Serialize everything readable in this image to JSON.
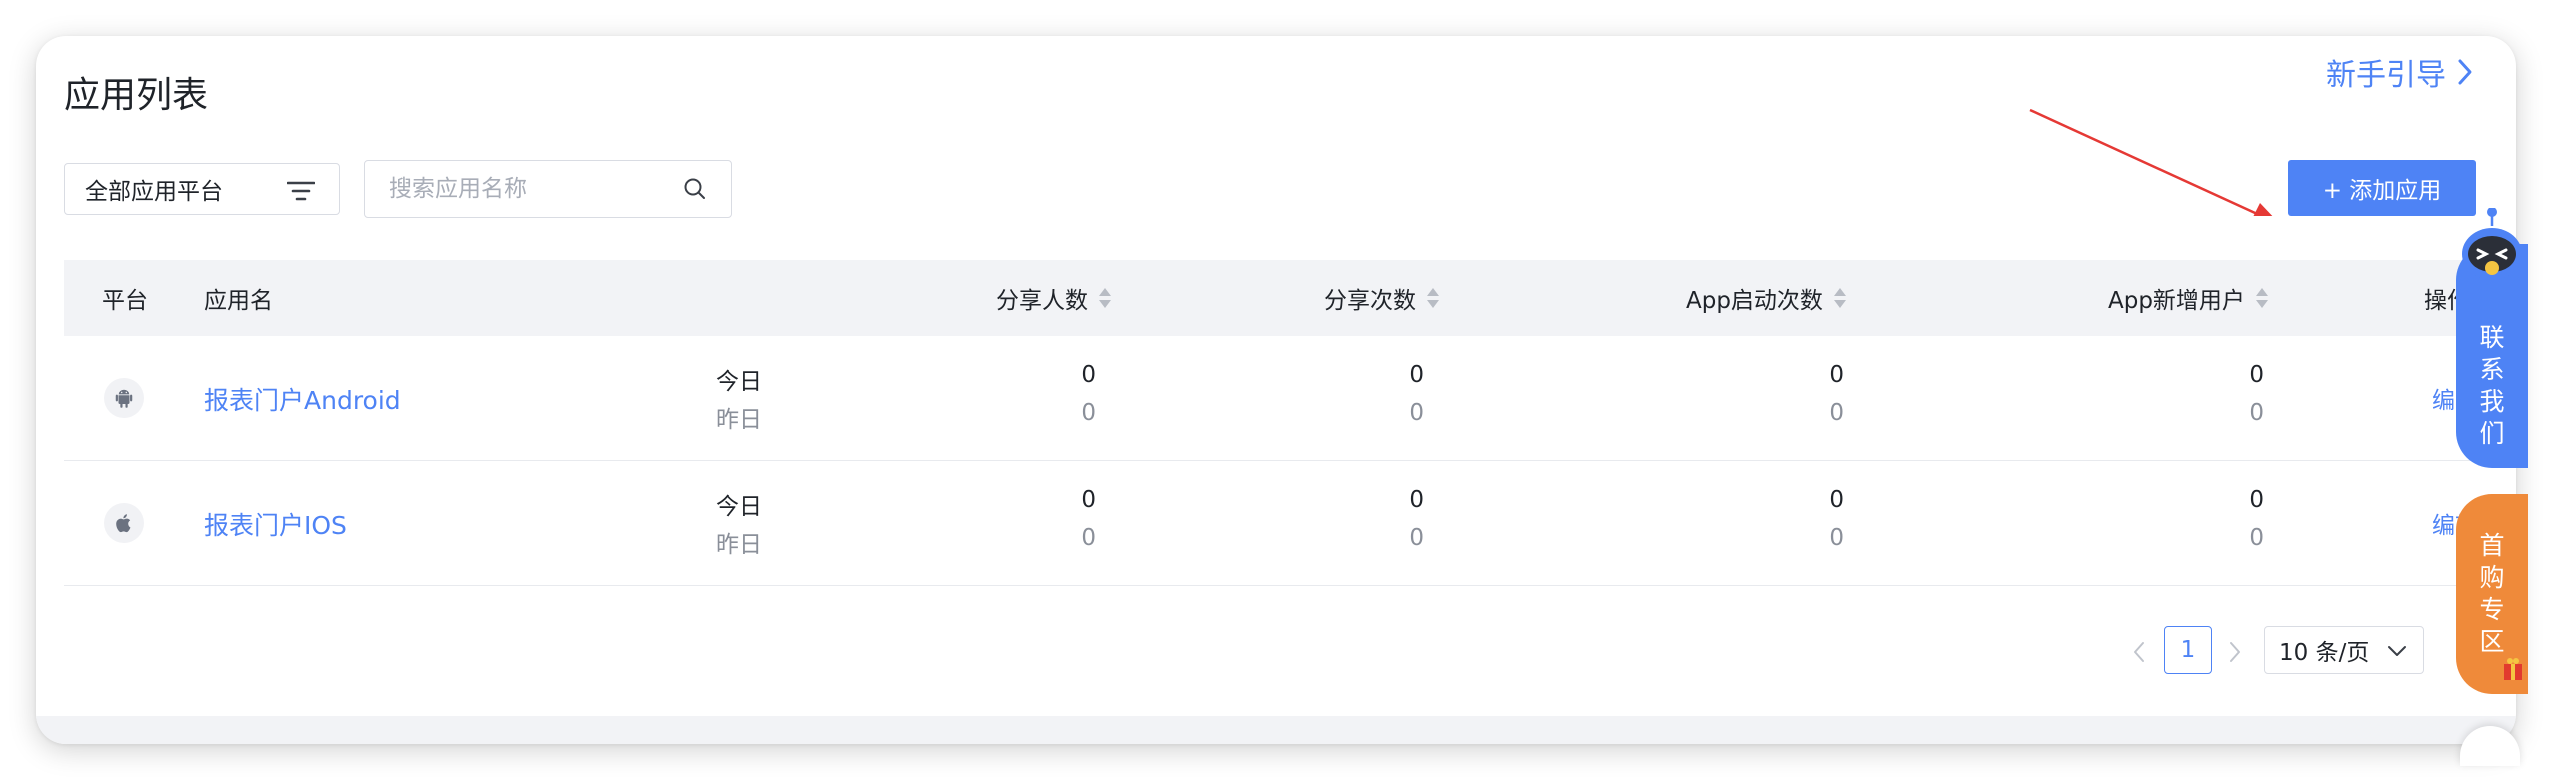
{
  "header": {
    "title": "应用列表",
    "guide_link": "新手引导"
  },
  "filters": {
    "platform_select": "全部应用平台",
    "search_placeholder": "搜索应用名称"
  },
  "toolbar": {
    "add_button": "+ 添加应用"
  },
  "table": {
    "columns": {
      "platform": "平台",
      "app_name": "应用名",
      "share_users": "分享人数",
      "share_count": "分享次数",
      "app_launches": "App启动次数",
      "new_users": "App新增用户",
      "actions": "操作"
    },
    "today_label": "今日",
    "yesterday_label": "昨日",
    "edit_label": "编辑",
    "rows": [
      {
        "platform_icon": "android-icon",
        "name": "报表门户Android",
        "share_users": {
          "today": "0",
          "yesterday": "0"
        },
        "share_count": {
          "today": "0",
          "yesterday": "0"
        },
        "app_launches": {
          "today": "0",
          "yesterday": "0"
        },
        "new_users": {
          "today": "0",
          "yesterday": "0"
        }
      },
      {
        "platform_icon": "apple-icon",
        "name": "报表门户IOS",
        "share_users": {
          "today": "0",
          "yesterday": "0"
        },
        "share_count": {
          "today": "0",
          "yesterday": "0"
        },
        "app_launches": {
          "today": "0",
          "yesterday": "0"
        },
        "new_users": {
          "today": "0",
          "yesterday": "0"
        }
      }
    ]
  },
  "pagination": {
    "current_page": "1",
    "page_size": "10 条/页"
  },
  "floating": {
    "contact_chars": [
      "联",
      "系",
      "我",
      "们"
    ],
    "promo_chars": [
      "首",
      "购",
      "专",
      "区"
    ]
  },
  "colors": {
    "accent": "#4e83f5",
    "promo": "#ef8a3a",
    "annotation_arrow": "#e53935"
  }
}
